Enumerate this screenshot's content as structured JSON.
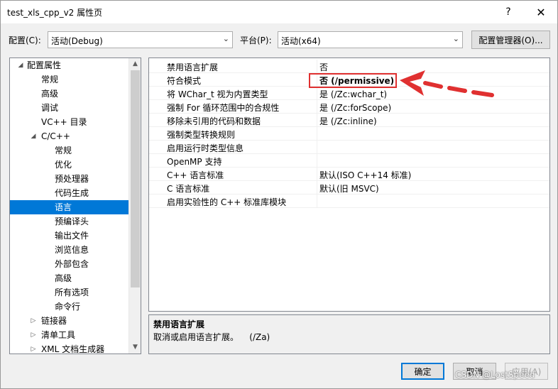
{
  "window": {
    "title": "test_xls_cpp_v2 属性页",
    "help_glyph": "?",
    "close_glyph": "✕"
  },
  "config_bar": {
    "config_label": "配置(C):",
    "config_value": "活动(Debug)",
    "platform_label": "平台(P):",
    "platform_value": "活动(x64)",
    "manager_button": "配置管理器(O)..."
  },
  "tree": {
    "items": [
      {
        "label": "配置属性",
        "toggle": "◢",
        "level": 0
      },
      {
        "label": "常规",
        "toggle": "",
        "level": 1
      },
      {
        "label": "高级",
        "toggle": "",
        "level": 1
      },
      {
        "label": "调试",
        "toggle": "",
        "level": 1
      },
      {
        "label": "VC++ 目录",
        "toggle": "",
        "level": 1
      },
      {
        "label": "C/C++",
        "toggle": "◢",
        "level": 1
      },
      {
        "label": "常规",
        "toggle": "",
        "level": 2
      },
      {
        "label": "优化",
        "toggle": "",
        "level": 2
      },
      {
        "label": "预处理器",
        "toggle": "",
        "level": 2
      },
      {
        "label": "代码生成",
        "toggle": "",
        "level": 2
      },
      {
        "label": "语言",
        "toggle": "",
        "level": 2,
        "selected": true
      },
      {
        "label": "预编译头",
        "toggle": "",
        "level": 2
      },
      {
        "label": "输出文件",
        "toggle": "",
        "level": 2
      },
      {
        "label": "浏览信息",
        "toggle": "",
        "level": 2
      },
      {
        "label": "外部包含",
        "toggle": "",
        "level": 2
      },
      {
        "label": "高级",
        "toggle": "",
        "level": 2
      },
      {
        "label": "所有选项",
        "toggle": "",
        "level": 2
      },
      {
        "label": "命令行",
        "toggle": "",
        "level": 2
      },
      {
        "label": "链接器",
        "toggle": "▷",
        "level": 1
      },
      {
        "label": "清单工具",
        "toggle": "▷",
        "level": 1
      },
      {
        "label": "XML 文档生成器",
        "toggle": "▷",
        "level": 1
      }
    ],
    "scroll_up": "▲",
    "scroll_down": "▼"
  },
  "properties": [
    {
      "name": "禁用语言扩展",
      "value": "否"
    },
    {
      "name": "符合模式",
      "value": "否 (/permissive)",
      "bold": true
    },
    {
      "name": "将 WChar_t 视为内置类型",
      "value": "是 (/Zc:wchar_t)"
    },
    {
      "name": "强制 For 循环范围中的合规性",
      "value": "是 (/Zc:forScope)"
    },
    {
      "name": "移除未引用的代码和数据",
      "value": "是 (/Zc:inline)"
    },
    {
      "name": "强制类型转换规则",
      "value": ""
    },
    {
      "name": "启用运行时类型信息",
      "value": ""
    },
    {
      "name": "OpenMP 支持",
      "value": ""
    },
    {
      "name": "C++ 语言标准",
      "value": "默认(ISO C++14 标准)"
    },
    {
      "name": "C 语言标准",
      "value": "默认(旧 MSVC)"
    },
    {
      "name": "启用实验性的 C++ 标准库模块",
      "value": ""
    }
  ],
  "description": {
    "title": "禁用语言扩展",
    "text": "取消或启用语言扩展。    (/Za)"
  },
  "buttons": {
    "ok": "确定",
    "cancel": "取消",
    "apply": "应用(A)"
  },
  "watermark": "CSDN @LostSpeed",
  "colors": {
    "selection": "#0078d7",
    "annotation_red": "#e03030"
  }
}
